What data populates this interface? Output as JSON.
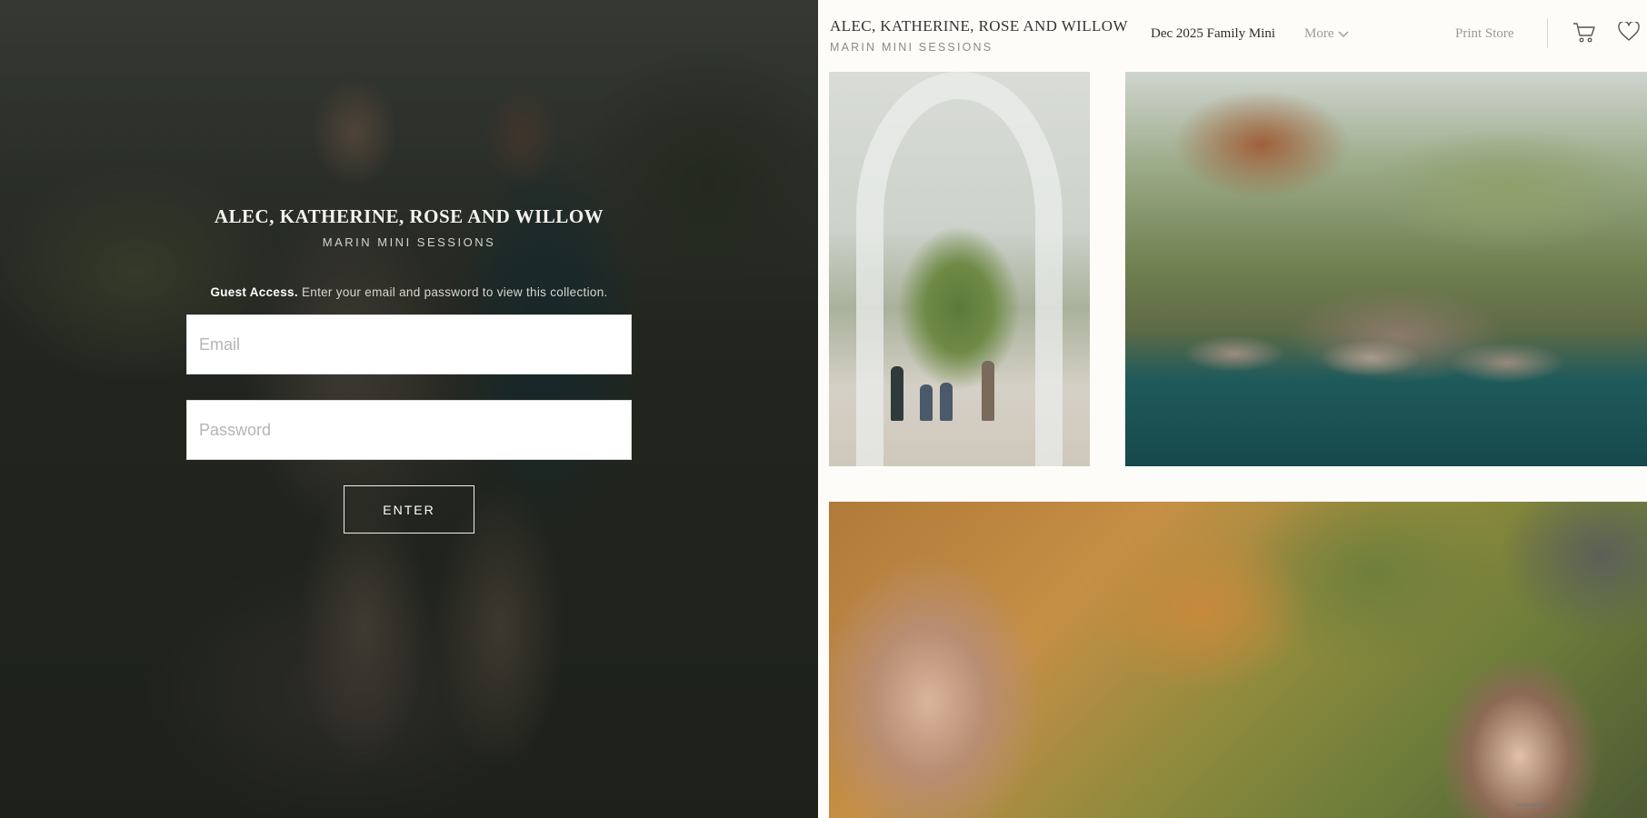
{
  "login": {
    "title": "ALEC, KATHERINE, ROSE AND WILLOW",
    "subtitle": "MARIN MINI SESSIONS",
    "guest_label": "Guest Access.",
    "guest_text": "Enter your email and password to view this collection.",
    "email_placeholder": "Email",
    "password_placeholder": "Password",
    "enter_label": "ENTER"
  },
  "header": {
    "brand_title": "ALEC, KATHERINE, ROSE AND WILLOW",
    "brand_subtitle": "MARIN MINI SESSIONS",
    "current_set": "Dec 2025 Family Mini",
    "more_label": "More",
    "print_store_label": "Print Store"
  },
  "icons": {
    "more": "chevron-down-icon",
    "cart": "cart-icon",
    "favorites": "heart-icon"
  }
}
